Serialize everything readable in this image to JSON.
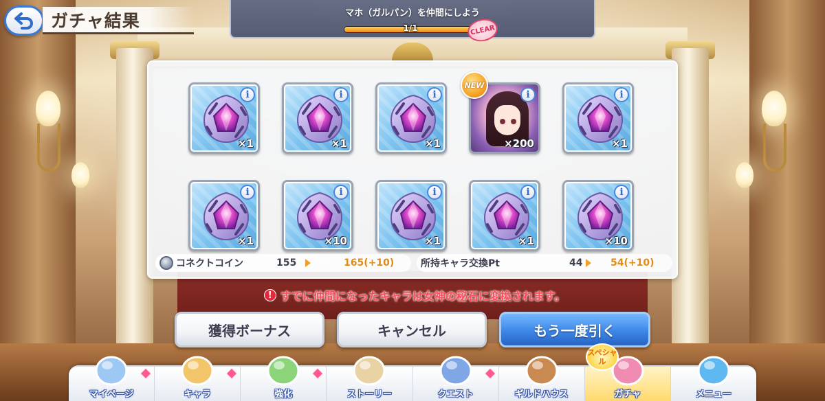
{
  "header": {
    "title": "ガチャ結果"
  },
  "mission": {
    "text": "マホ（ガルパン）を仲間にしよう",
    "progress_text": "1/1",
    "progress_fraction": 1.0,
    "clear_label": "CLEAR"
  },
  "results": {
    "items": [
      {
        "kind": "stone",
        "quantity": "×1"
      },
      {
        "kind": "stone",
        "quantity": "×1"
      },
      {
        "kind": "stone",
        "quantity": "×1"
      },
      {
        "kind": "character",
        "quantity": "×200",
        "badge": "NEW"
      },
      {
        "kind": "stone",
        "quantity": "×1"
      },
      {
        "kind": "stone",
        "quantity": "×1"
      },
      {
        "kind": "stone",
        "quantity": "×10"
      },
      {
        "kind": "stone",
        "quantity": "×1"
      },
      {
        "kind": "stone",
        "quantity": "×1"
      },
      {
        "kind": "stone",
        "quantity": "×10"
      }
    ],
    "info_label": "i"
  },
  "status": {
    "coin": {
      "label": "コネクトコイン",
      "before": "155",
      "after": "165(+10)"
    },
    "pt": {
      "label": "所持キャラ交換Pt",
      "before": "44",
      "after": "54(+10)"
    }
  },
  "warning": {
    "icon": "!",
    "text": "すでに仲間になったキャラは女神の秘石に変換されます。"
  },
  "buttons": {
    "bonus": "獲得ボーナス",
    "cancel": "キャンセル",
    "again": "もう一度引く"
  },
  "nav": {
    "items": [
      {
        "label": "マイページ",
        "icon": "castle-icon",
        "badge": true
      },
      {
        "label": "キャラ",
        "icon": "character-icon",
        "badge": true
      },
      {
        "label": "強化",
        "icon": "orbs-icon",
        "badge": true
      },
      {
        "label": "ストーリー",
        "icon": "scroll-icon",
        "badge": false
      },
      {
        "label": "クエスト",
        "icon": "sword-flag-icon",
        "badge": true
      },
      {
        "label": "ギルドハウス",
        "icon": "door-icon",
        "badge": false
      },
      {
        "label": "ガチャ",
        "icon": "gacha-icon",
        "badge": false,
        "active": true
      },
      {
        "label": "メニュー",
        "icon": "crystal-icon",
        "badge": false
      }
    ],
    "special_badge": "スペシャル"
  },
  "colors": {
    "accent_blue": "#3d87e8",
    "warning_red": "#ff4a58",
    "gain_orange": "#e48a12"
  }
}
